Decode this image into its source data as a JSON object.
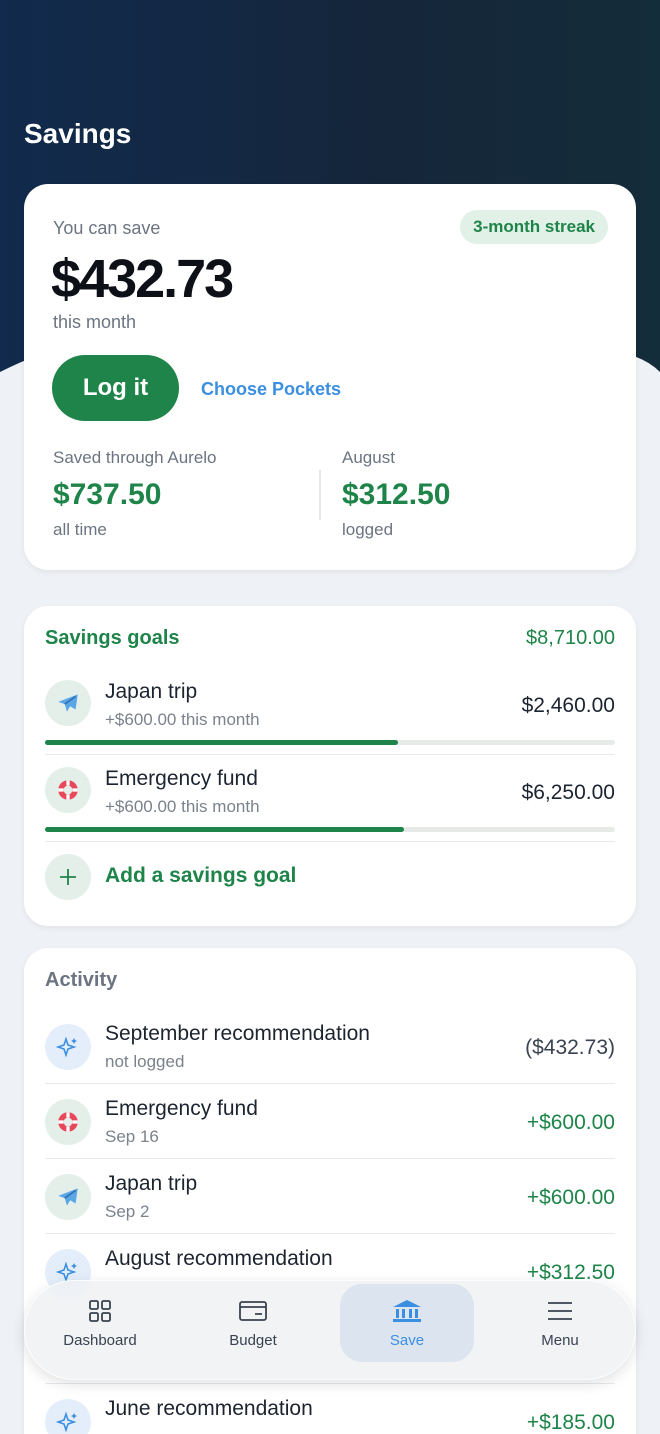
{
  "page": {
    "title": "Savings"
  },
  "save_card": {
    "label": "You can save",
    "streak": "3-month streak",
    "amount": "$432.73",
    "period": "this month",
    "log_button": "Log it",
    "pockets_link": "Choose Pockets",
    "stats": [
      {
        "label": "Saved through Aurelo",
        "value": "$737.50",
        "sub": "all time"
      },
      {
        "label": "August",
        "value": "$312.50",
        "sub": "logged"
      }
    ]
  },
  "goals": {
    "title": "Savings goals",
    "total": "$8,710.00",
    "items": [
      {
        "name": "Japan trip",
        "sub": "+$600.00 this month",
        "amount": "$2,460.00",
        "icon": "airplane-icon",
        "progress": 0.62
      },
      {
        "name": "Emergency fund",
        "sub": "+$600.00 this month",
        "amount": "$6,250.00",
        "icon": "lifebuoy-icon",
        "progress": 0.63
      }
    ],
    "add_label": "Add a savings goal"
  },
  "activity": {
    "title": "Activity",
    "items": [
      {
        "title": "September recommendation",
        "sub": "not logged",
        "amount": "($432.73)",
        "icon": "sparkle-icon"
      },
      {
        "title": "Emergency fund",
        "sub": "Sep 16",
        "amount": "+$600.00",
        "icon": "lifebuoy-icon"
      },
      {
        "title": "Japan trip",
        "sub": "Sep 2",
        "amount": "+$600.00",
        "icon": "airplane-icon"
      },
      {
        "title": "August recommendation",
        "sub": "",
        "amount": "+$312.50",
        "icon": "sparkle-icon"
      },
      {
        "title": "",
        "sub": "",
        "amount": "",
        "icon": ""
      },
      {
        "title": "June recommendation",
        "sub": "",
        "amount": "+$185.00",
        "icon": "sparkle-icon"
      }
    ]
  },
  "nav": {
    "items": [
      {
        "label": "Dashboard",
        "icon": "grid-icon"
      },
      {
        "label": "Budget",
        "icon": "card-icon"
      },
      {
        "label": "Save",
        "icon": "bank-icon"
      },
      {
        "label": "Menu",
        "icon": "menu-icon"
      }
    ],
    "active": "Save"
  },
  "colors": {
    "accent_green": "#1e8449",
    "link_blue": "#3b8fe0",
    "header_navy": "#112a4d"
  }
}
